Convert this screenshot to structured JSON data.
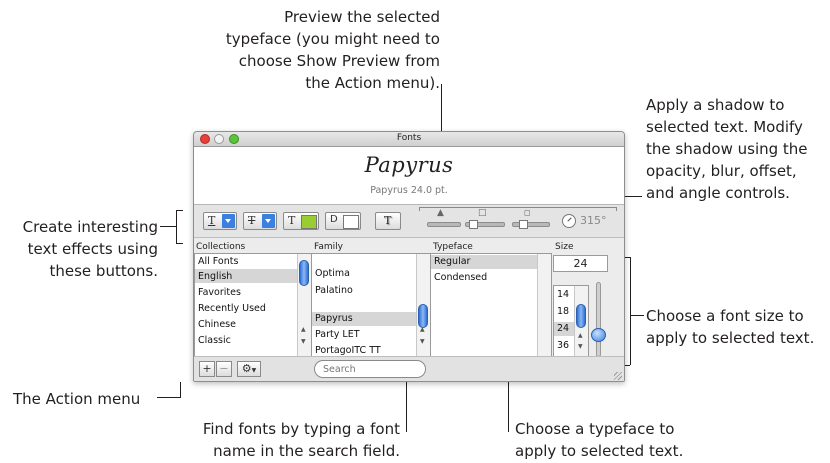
{
  "callouts": {
    "preview_line1": "Preview the selected",
    "preview_line2": "typeface (you might need to",
    "preview_line3": "choose Show Preview from",
    "preview_line4": "the Action menu).",
    "shadow_line1": "Apply a shadow to",
    "shadow_line2": "selected text. Modify",
    "shadow_line3": "the shadow using the",
    "shadow_line4": "opacity, blur, offset,",
    "shadow_line5": "and angle controls.",
    "effects_line1": "Create interesting",
    "effects_line2": "text effects using",
    "effects_line3": "these buttons.",
    "size_line1": "Choose a font size to",
    "size_line2": "apply to selected text.",
    "action": "The Action menu",
    "search_line1": "Find fonts by typing a font",
    "search_line2": "name in the search field.",
    "typeface_line1": "Choose a typeface to",
    "typeface_line2": "apply to selected text."
  },
  "window": {
    "title": "Fonts",
    "preview": {
      "font_name": "Papyrus",
      "size_text": "Papyrus 24.0 pt."
    },
    "toolbar": {
      "underline_glyph": "T",
      "strike_glyph": "T",
      "text_color_glyph": "T",
      "doc_color_glyph": "D",
      "shadow_glyph": "T",
      "text_color": "#9acd32",
      "angle": "315°"
    },
    "collections": {
      "header": "Collections",
      "items": [
        "All Fonts",
        "English",
        "Favorites",
        "Recently Used",
        "Chinese",
        "Classic"
      ],
      "selected": "English"
    },
    "family": {
      "header": "Family",
      "items": [
        "Optima",
        "Palatino",
        "Papyrus",
        "Party LET",
        "PortagoITC TT"
      ],
      "selected": "Papyrus"
    },
    "typeface": {
      "header": "Typeface",
      "items": [
        "Regular",
        "Condensed"
      ],
      "selected": "Regular"
    },
    "size": {
      "header": "Size",
      "value": "24",
      "items": [
        "14",
        "18",
        "24",
        "36"
      ],
      "selected": "24",
      "slider_level": 0.3
    },
    "bottombar": {
      "add": "+",
      "remove": "−",
      "action_icon": "⚙",
      "search_placeholder": "Search"
    }
  }
}
